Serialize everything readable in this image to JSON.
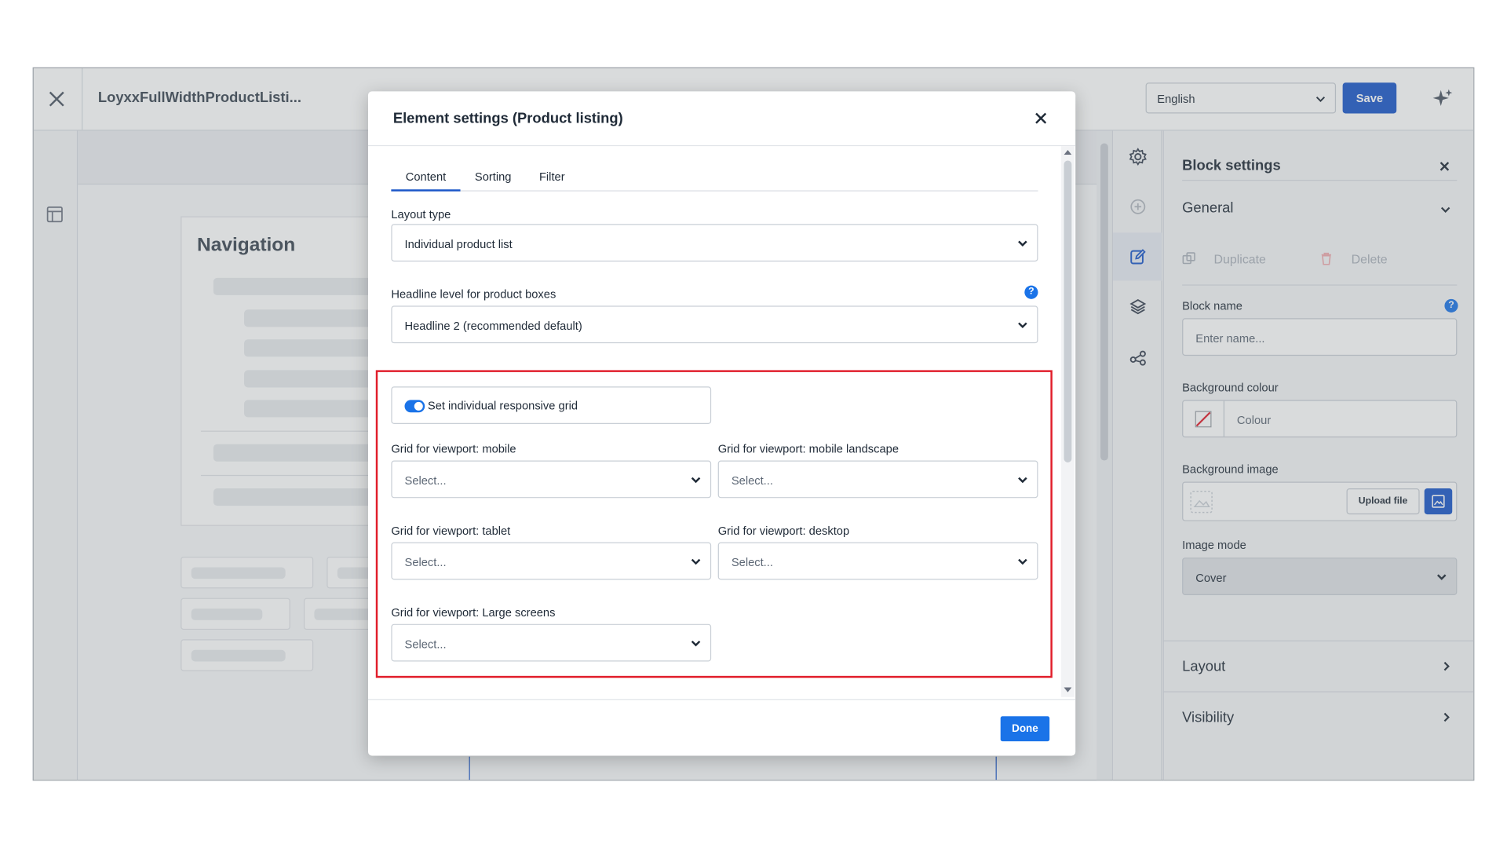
{
  "app": {
    "document_title": "LoyxxFullWidthProductListi...",
    "language_select": "English",
    "save_label": "Save"
  },
  "canvas": {
    "navigation_title": "Navigation"
  },
  "modal": {
    "title": "Element settings (Product listing)",
    "tabs": [
      "Content",
      "Sorting",
      "Filter"
    ],
    "active_tab": "Content",
    "layout_type_label": "Layout type",
    "layout_type_value": "Individual product list",
    "headline_label": "Headline level for product boxes",
    "headline_value": "Headline 2 (recommended default)",
    "responsive_toggle_label": "Set individual responsive grid",
    "responsive_toggle_on": true,
    "grids": [
      {
        "label": "Grid for viewport: mobile",
        "value": "Select..."
      },
      {
        "label": "Grid for viewport: mobile landscape",
        "value": "Select..."
      },
      {
        "label": "Grid for viewport: tablet",
        "value": "Select..."
      },
      {
        "label": "Grid for viewport: desktop",
        "value": "Select..."
      },
      {
        "label": "Grid for viewport: Large screens",
        "value": "Select..."
      }
    ],
    "done_label": "Done"
  },
  "block_settings": {
    "title": "Block settings",
    "general_label": "General",
    "duplicate_label": "Duplicate",
    "delete_label": "Delete",
    "block_name_label": "Block name",
    "block_name_placeholder": "Enter name...",
    "background_colour_label": "Background colour",
    "colour_placeholder": "Colour",
    "background_image_label": "Background image",
    "upload_label": "Upload file",
    "image_mode_label": "Image mode",
    "image_mode_value": "Cover",
    "layout_label": "Layout",
    "visibility_label": "Visibility"
  },
  "colors": {
    "primary": "#1a56c9",
    "accent": "#1a73e8",
    "highlight": "#e11d2a"
  }
}
